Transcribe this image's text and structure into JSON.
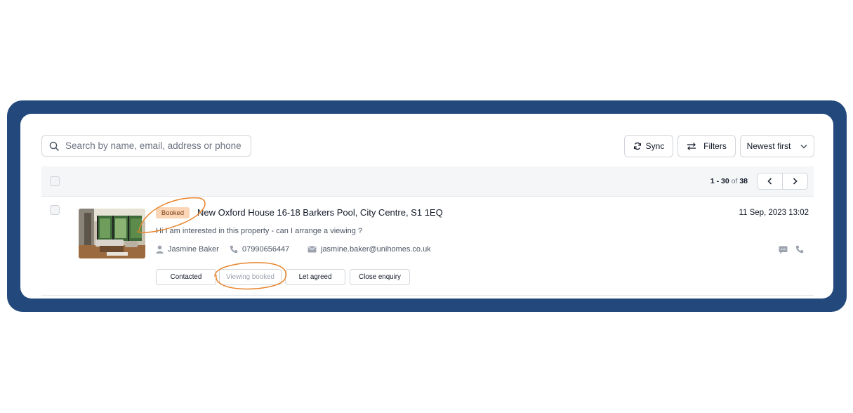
{
  "search": {
    "placeholder": "Search by name, email, address or phone",
    "icon": "search-icon"
  },
  "toolbar": {
    "sync_label": "Sync",
    "filters_label": "Filters",
    "sort_label": "Newest first"
  },
  "pagination": {
    "range": "1 - 30",
    "of": "of",
    "total": "38"
  },
  "enquiry": {
    "status_badge": "Booked",
    "address": "New Oxford House 16-18 Barkers Pool, City Centre, S1 1EQ",
    "date": "11 Sep, 2023 13:02",
    "message": "Hi I am interested in this property - can I arrange a viewing ?",
    "name": "Jasmine Baker",
    "phone": "07990656447",
    "email": "jasmine.baker@unihomes.co.uk",
    "status_buttons": [
      "Contacted",
      "Viewing booked",
      "Let agreed",
      "Close enquiry"
    ]
  },
  "colors": {
    "frame": "#23497c",
    "badge_bg": "#fad6b6",
    "annotation": "#e8842a"
  }
}
